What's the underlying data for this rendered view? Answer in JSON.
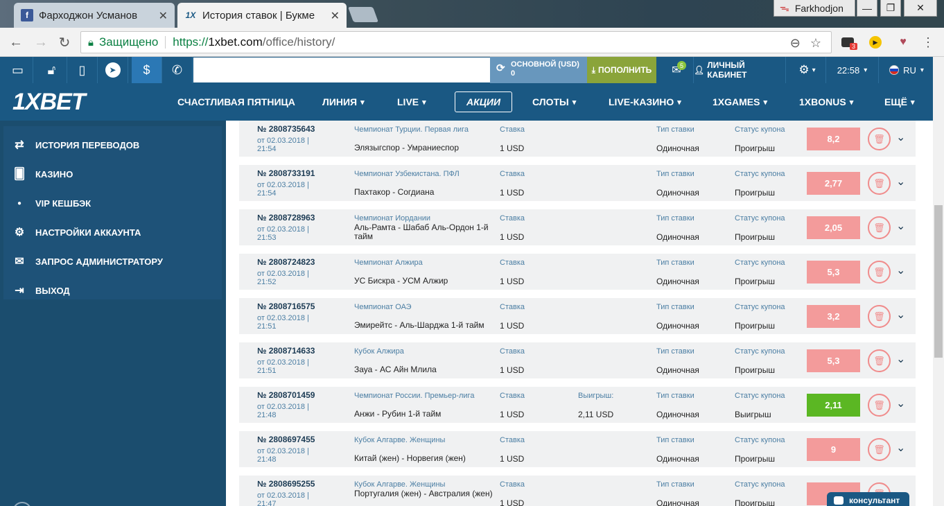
{
  "browser": {
    "tabs": [
      {
        "title": "Фарходжон Усманов",
        "icon": "facebook-icon"
      },
      {
        "title": "История ставок | Букме",
        "icon": "1x-icon"
      }
    ],
    "user": "Farkhodjon",
    "secure_label": "Защищено",
    "url_scheme": "https://",
    "url_host": "1xbet.com",
    "url_path": "/office/history/",
    "ext_badge": "3"
  },
  "topbar": {
    "balance_label": "ОСНОВНОЙ (USD)",
    "balance_value": "0",
    "deposit_label": "ПОПОЛНИТЬ",
    "mail_badge": "5",
    "cabinet_label": "ЛИЧНЫЙ КАБИНЕТ",
    "time": "22:58",
    "lang": "RU"
  },
  "nav": {
    "logo": "1XBET",
    "items": [
      "СЧАСТЛИВАЯ ПЯТНИЦА",
      "ЛИНИЯ",
      "LIVE",
      "АКЦИИ",
      "СЛОТЫ",
      "LIVE-КАЗИНО",
      "1XGAMES",
      "1XBONUS",
      "ЕЩЁ"
    ]
  },
  "sidebar": {
    "items": [
      {
        "label": "ИСТОРИЯ ПЕРЕВОДОВ",
        "icon": "transfer-arrows-icon"
      },
      {
        "label": "КАЗИНО",
        "icon": "cards-icon"
      },
      {
        "label": "VIP КЕШБЭК",
        "icon": "bullet-icon"
      },
      {
        "label": "НАСТРОЙКИ АККАУНТА",
        "icon": "gears-icon"
      },
      {
        "label": "ЗАПРОС АДМИНИСТРАТОРУ",
        "icon": "envelope-icon"
      },
      {
        "label": "ВЫХОД",
        "icon": "exit-icon"
      }
    ]
  },
  "labels": {
    "stake": "Ставка",
    "winnings": "Выигрыш:",
    "bet_type": "Тип ставки",
    "coupon_status": "Статус купона"
  },
  "bets": [
    {
      "num": "№ 2808735643",
      "date": "от 02.03.2018 |",
      "time": "21:54",
      "league": "Чемпионат Турции. Первая лига",
      "match": "Элязыгспор - Умраниеспор",
      "stake": "1 USD",
      "win": "",
      "type": "Одиночная",
      "status": "Проигрыш",
      "coef": "8,2",
      "result": "lose"
    },
    {
      "num": "№ 2808733191",
      "date": "от 02.03.2018 |",
      "time": "21:54",
      "league": "Чемпионат Узбекистана. ПФЛ",
      "match": "Пахтакор - Согдиана",
      "stake": "1 USD",
      "win": "",
      "type": "Одиночная",
      "status": "Проигрыш",
      "coef": "2,77",
      "result": "lose"
    },
    {
      "num": "№ 2808728963",
      "date": "от 02.03.2018 |",
      "time": "21:53",
      "league": "Чемпионат Иордании",
      "match": "Аль-Рамта - Шабаб Аль-Ордон 1-й тайм",
      "stake": "1 USD",
      "win": "",
      "type": "Одиночная",
      "status": "Проигрыш",
      "coef": "2,05",
      "result": "lose"
    },
    {
      "num": "№ 2808724823",
      "date": "от 02.03.2018 |",
      "time": "21:52",
      "league": "Чемпионат Алжира",
      "match": "УС Бискра - УСМ Алжир",
      "stake": "1 USD",
      "win": "",
      "type": "Одиночная",
      "status": "Проигрыш",
      "coef": "5,3",
      "result": "lose"
    },
    {
      "num": "№ 2808716575",
      "date": "от 02.03.2018 |",
      "time": "21:51",
      "league": "Чемпионат ОАЭ",
      "match": "Эмирейтс - Аль-Шарджа 1-й тайм",
      "stake": "1 USD",
      "win": "",
      "type": "Одиночная",
      "status": "Проигрыш",
      "coef": "3,2",
      "result": "lose"
    },
    {
      "num": "№ 2808714633",
      "date": "от 02.03.2018 |",
      "time": "21:51",
      "league": "Кубок Алжира",
      "match": "Зауа - АС Айн Млила",
      "stake": "1 USD",
      "win": "",
      "type": "Одиночная",
      "status": "Проигрыш",
      "coef": "5,3",
      "result": "lose"
    },
    {
      "num": "№ 2808701459",
      "date": "от 02.03.2018 |",
      "time": "21:48",
      "league": "Чемпионат России. Премьер-лига",
      "match": "Анжи - Рубин 1-й тайм",
      "stake": "1 USD",
      "win": "2,11 USD",
      "type": "Одиночная",
      "status": "Выигрыш",
      "coef": "2,11",
      "result": "win"
    },
    {
      "num": "№ 2808697455",
      "date": "от 02.03.2018 |",
      "time": "21:48",
      "league": "Кубок Алгарве. Женщины",
      "match": "Китай (жен) - Норвегия (жен)",
      "stake": "1 USD",
      "win": "",
      "type": "Одиночная",
      "status": "Проигрыш",
      "coef": "9",
      "result": "lose"
    },
    {
      "num": "№ 2808695255",
      "date": "от 02.03.2018 |",
      "time": "21:47",
      "league": "Кубок Алгарве. Женщины",
      "match": "Португалия (жен) - Австралия (жен)",
      "stake": "1 USD",
      "win": "",
      "type": "Одиночная",
      "status": "Проигрыш",
      "coef": "",
      "result": "lose"
    }
  ],
  "consultant_label": "консультант"
}
